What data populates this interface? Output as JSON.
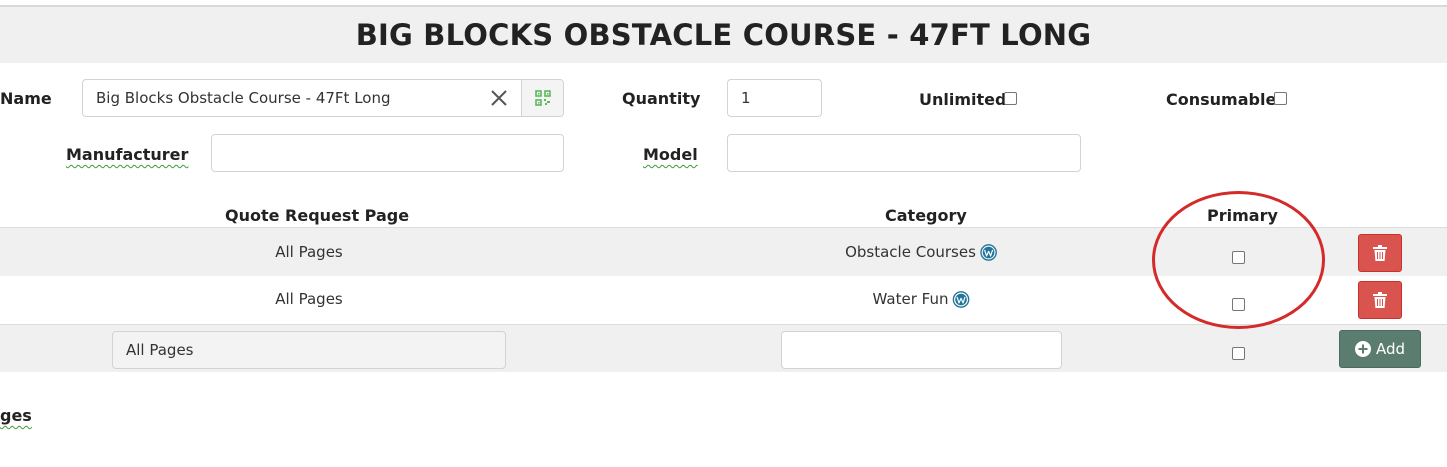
{
  "page": {
    "title": "BIG BLOCKS OBSTACLE COURSE - 47FT LONG"
  },
  "form": {
    "name_label": "Name",
    "name_value": "Big Blocks Obstacle Course - 47Ft Long",
    "quantity_label": "Quantity",
    "quantity_value": "1",
    "unlimited_label": "Unlimited",
    "consumable_label": "Consumable",
    "manufacturer_label": "Manufacturer",
    "manufacturer_value": "",
    "model_label": "Model",
    "model_value": ""
  },
  "table": {
    "headers": {
      "quote_request_page": "Quote Request Page",
      "category": "Category",
      "primary": "Primary"
    },
    "rows": [
      {
        "quote_page": "All Pages",
        "category": "Obstacle Courses",
        "primary": false
      },
      {
        "quote_page": "All Pages",
        "category": "Water Fun",
        "primary": false
      }
    ],
    "new_row": {
      "quote_page_value": "All Pages",
      "category_value": "",
      "primary": false,
      "add_label": "Add"
    }
  },
  "footer": {
    "partial_label": "ges"
  },
  "colors": {
    "delete_button": "#d9534f",
    "add_button": "#5a7d70",
    "annotation": "#d42a2a",
    "qr_icon": "#5cb85c"
  },
  "icons": {
    "clear": "close-icon",
    "qr": "qr-code-icon",
    "category_link": "wordpress-icon",
    "delete": "trash-icon",
    "add": "plus-circle-icon"
  }
}
